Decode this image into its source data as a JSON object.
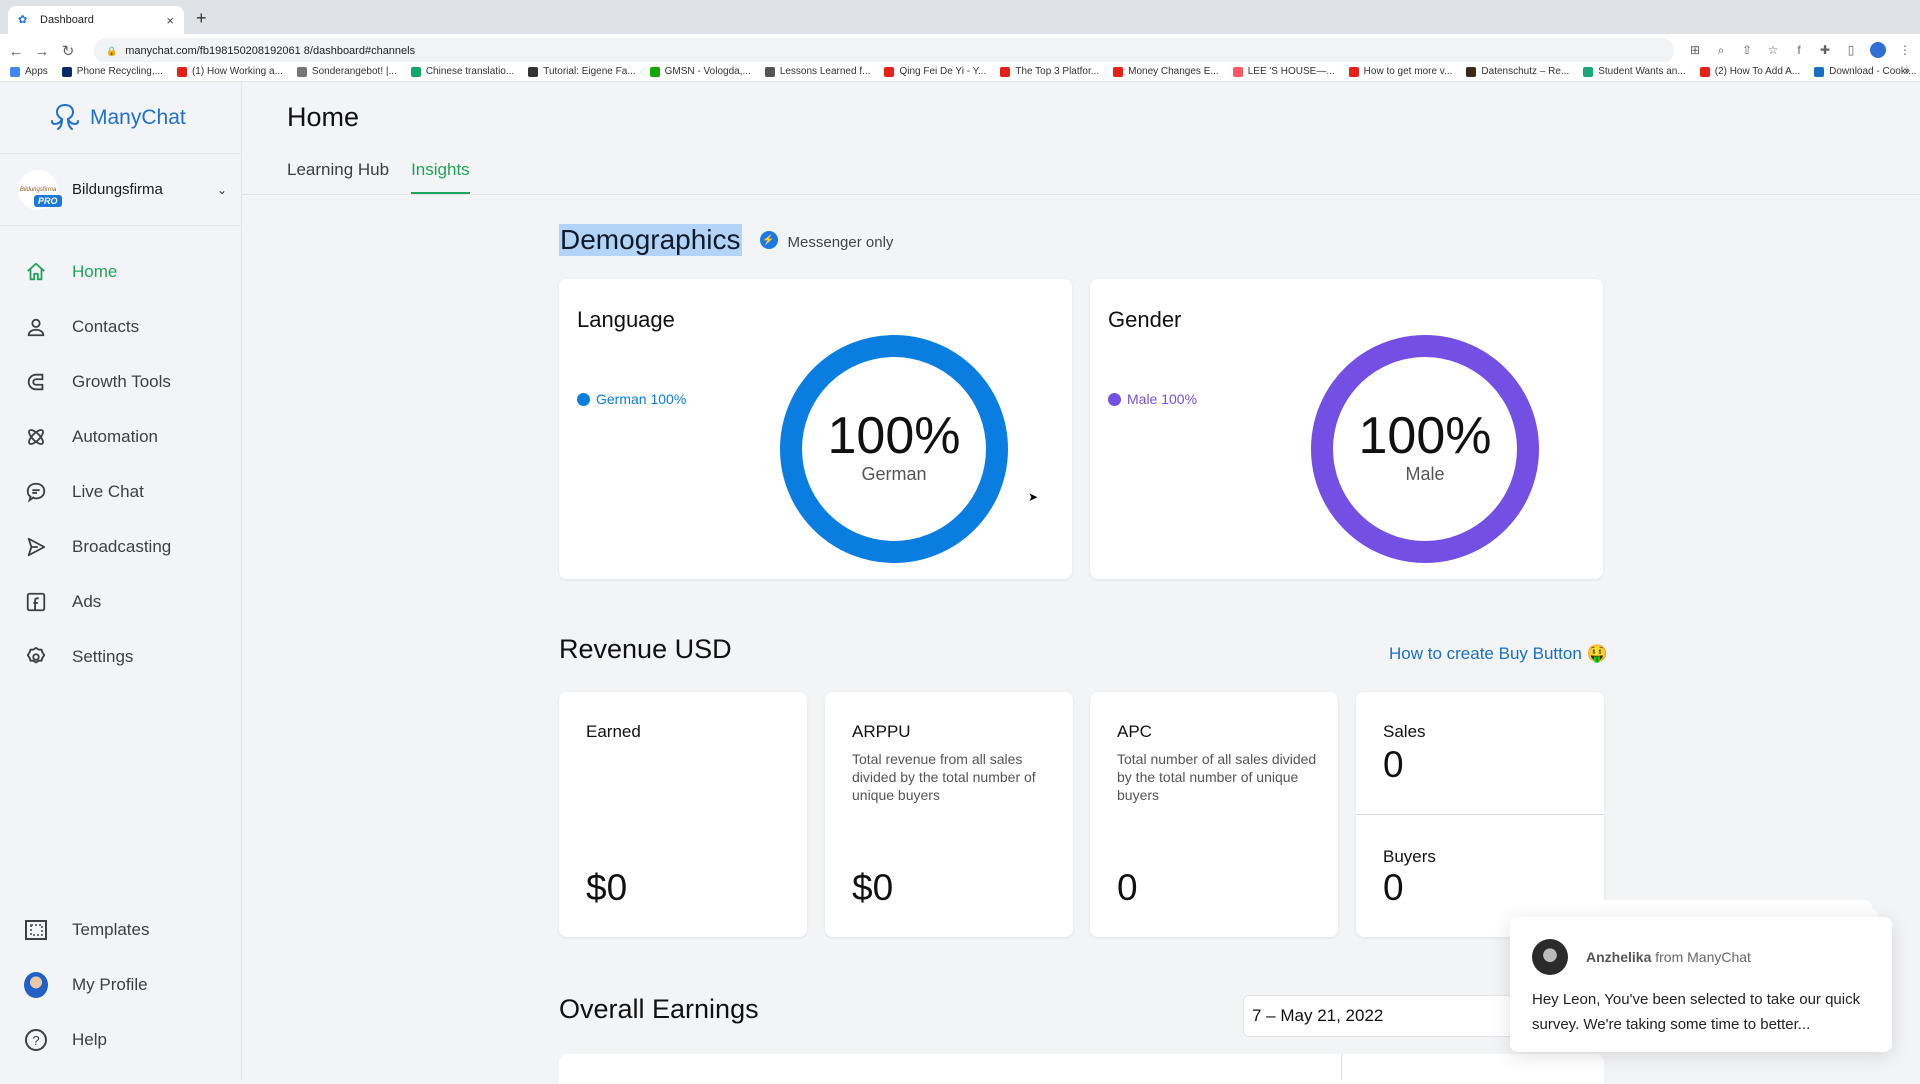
{
  "browser": {
    "tab_title": "Dashboard",
    "url": "manychat.com/fb198150208192061 8/dashboard#channels",
    "bookmarks": [
      {
        "label": "Apps",
        "icon": "apps-grid-icon",
        "color": "#4285f4"
      },
      {
        "label": "Phone Recycling,...",
        "icon": "o2-icon",
        "color": "#0a2a6b"
      },
      {
        "label": "(1) How Working a...",
        "icon": "youtube-icon",
        "color": "#e62117"
      },
      {
        "label": "Sonderangebot! |...",
        "icon": "check-circle-icon",
        "color": "#777777"
      },
      {
        "label": "Chinese translatio...",
        "icon": "translate-icon",
        "color": "#13a86b"
      },
      {
        "label": "Tutorial: Eigene Fa...",
        "icon": "hashtag-icon",
        "color": "#333333"
      },
      {
        "label": "GMSN - Vologda,...",
        "icon": "upwork-icon",
        "color": "#14a800"
      },
      {
        "label": "Lessons Learned f...",
        "icon": "er-icon",
        "color": "#555555"
      },
      {
        "label": "Qing Fei De Yi - Y...",
        "icon": "youtube-icon",
        "color": "#e62117"
      },
      {
        "label": "The Top 3 Platfor...",
        "icon": "youtube-icon",
        "color": "#e62117"
      },
      {
        "label": "Money Changes E...",
        "icon": "youtube-icon",
        "color": "#e62117"
      },
      {
        "label": "LEE 'S HOUSE—...",
        "icon": "airbnb-icon",
        "color": "#ff5a5f"
      },
      {
        "label": "How to get more v...",
        "icon": "youtube-icon",
        "color": "#e62117"
      },
      {
        "label": "Datenschutz – Re...",
        "icon": "bookmark-image-icon",
        "color": "#3a2a1a"
      },
      {
        "label": "Student Wants an...",
        "icon": "t-icon",
        "color": "#19a974"
      },
      {
        "label": "(2) How To Add A...",
        "icon": "youtube-icon",
        "color": "#e62117"
      },
      {
        "label": "Download - Cooki...",
        "icon": "cookie-icon",
        "color": "#1b6fc2"
      }
    ],
    "more_label": "»"
  },
  "sidebar": {
    "brand": "ManyChat",
    "account": {
      "name": "Bildungsfirma",
      "badge": "PRO",
      "logo_text": "Bildungsfirma"
    },
    "items": [
      {
        "label": "Home",
        "icon": "home-icon",
        "active": true
      },
      {
        "label": "Contacts",
        "icon": "user-icon"
      },
      {
        "label": "Growth Tools",
        "icon": "magnet-icon"
      },
      {
        "label": "Automation",
        "icon": "atom-icon"
      },
      {
        "label": "Live Chat",
        "icon": "chat-bubble-icon"
      },
      {
        "label": "Broadcasting",
        "icon": "send-icon"
      },
      {
        "label": "Ads",
        "icon": "facebook-icon"
      },
      {
        "label": "Settings",
        "icon": "gear-icon"
      }
    ],
    "bottom_items": [
      {
        "label": "Templates",
        "icon": "templates-icon"
      },
      {
        "label": "My Profile",
        "icon": "avatar"
      },
      {
        "label": "Help",
        "icon": "help-icon"
      }
    ]
  },
  "main": {
    "title": "Home",
    "tabs": [
      {
        "label": "Learning Hub",
        "active": false
      },
      {
        "label": "Insights",
        "active": true
      }
    ],
    "demographics": {
      "title": "Demographics",
      "channel_label": "Messenger only",
      "language": {
        "title": "Language",
        "legend": "German 100%",
        "value": "100%",
        "label": "German",
        "color": "#0a7de0"
      },
      "gender": {
        "title": "Gender",
        "legend": "Male 100%",
        "value": "100%",
        "label": "Male",
        "color": "#7350e3"
      }
    },
    "revenue": {
      "title": "Revenue USD",
      "help_link": "How to create Buy Button 🤑",
      "cards": [
        {
          "title": "Earned",
          "desc": "",
          "value": "$0"
        },
        {
          "title": "ARPPU",
          "desc": "Total revenue from all sales divided by the total number of unique buyers",
          "value": "$0"
        },
        {
          "title": "APC",
          "desc": "Total number of all sales divided by the total number of unique buyers",
          "value": "0"
        }
      ],
      "sales": {
        "title": "Sales",
        "value": "0"
      },
      "buyers": {
        "title": "Buyers",
        "value": "0"
      }
    },
    "earnings": {
      "title": "Overall Earnings",
      "date_range": "7 – May 21, 2022"
    }
  },
  "chat_widget": {
    "sender": "Anzhelika",
    "from": "from ManyChat",
    "message": "Hey Leon,  You've been selected to take our quick survey. We're taking some time to better..."
  },
  "colors": {
    "accent_green": "#22a35b",
    "brand_blue": "#1e6fd0",
    "language_blue": "#0a7de0",
    "gender_purple": "#7350e3"
  },
  "chart_data": [
    {
      "type": "pie",
      "title": "Language",
      "categories": [
        "German"
      ],
      "values": [
        100
      ],
      "unit": "%"
    },
    {
      "type": "pie",
      "title": "Gender",
      "categories": [
        "Male"
      ],
      "values": [
        100
      ],
      "unit": "%"
    }
  ]
}
